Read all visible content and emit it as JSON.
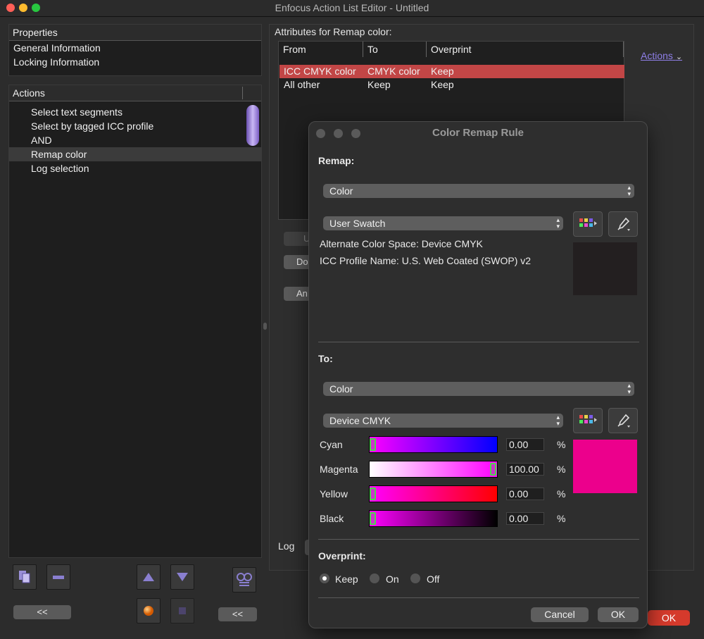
{
  "window": {
    "title": "Enfocus Action List Editor - Untitled"
  },
  "properties": {
    "header": "Properties",
    "items": [
      "General Information",
      "Locking Information"
    ]
  },
  "actions_panel": {
    "header": "Actions",
    "items": [
      "Select text segments",
      "Select by tagged ICC profile",
      "AND",
      "Remap color",
      "Log selection"
    ],
    "selected_index": 3,
    "collapse_left": "<<",
    "collapse_right": "<<"
  },
  "attributes": {
    "title": "Attributes for Remap color:",
    "columns": [
      "From",
      "To",
      "Overprint"
    ],
    "rows": [
      {
        "from": "ICC CMYK color",
        "to": "CMYK color",
        "overprint": "Keep"
      },
      {
        "from": "All other",
        "to": "Keep",
        "overprint": "Keep"
      }
    ],
    "actions_link": "Actions",
    "partial_buttons": [
      "U",
      "Do",
      "An"
    ],
    "log_label": "Log",
    "ok_label": "OK"
  },
  "dialog": {
    "title": "Color Remap Rule",
    "remap_label": "Remap:",
    "remap_type": "Color",
    "remap_swatch": "User Swatch",
    "alt_color_space": "Alternate Color Space: Device CMYK",
    "icc_profile": "ICC Profile Name: U.S. Web Coated (SWOP) v2",
    "remap_preview_color": "#231f20",
    "to_label": "To:",
    "to_type": "Color",
    "to_space": "Device CMYK",
    "channels": [
      {
        "name": "Cyan",
        "value": "0.00",
        "unit": "%",
        "fraction": 0.0
      },
      {
        "name": "Magenta",
        "value": "100.00",
        "unit": "%",
        "fraction": 1.0
      },
      {
        "name": "Yellow",
        "value": "0.00",
        "unit": "%",
        "fraction": 0.0
      },
      {
        "name": "Black",
        "value": "0.00",
        "unit": "%",
        "fraction": 0.0
      }
    ],
    "to_preview_color": "#ec008c",
    "overprint_label": "Overprint:",
    "overprint_options": [
      "Keep",
      "On",
      "Off"
    ],
    "overprint_selected": "Keep",
    "cancel_label": "Cancel",
    "ok_label": "OK"
  }
}
